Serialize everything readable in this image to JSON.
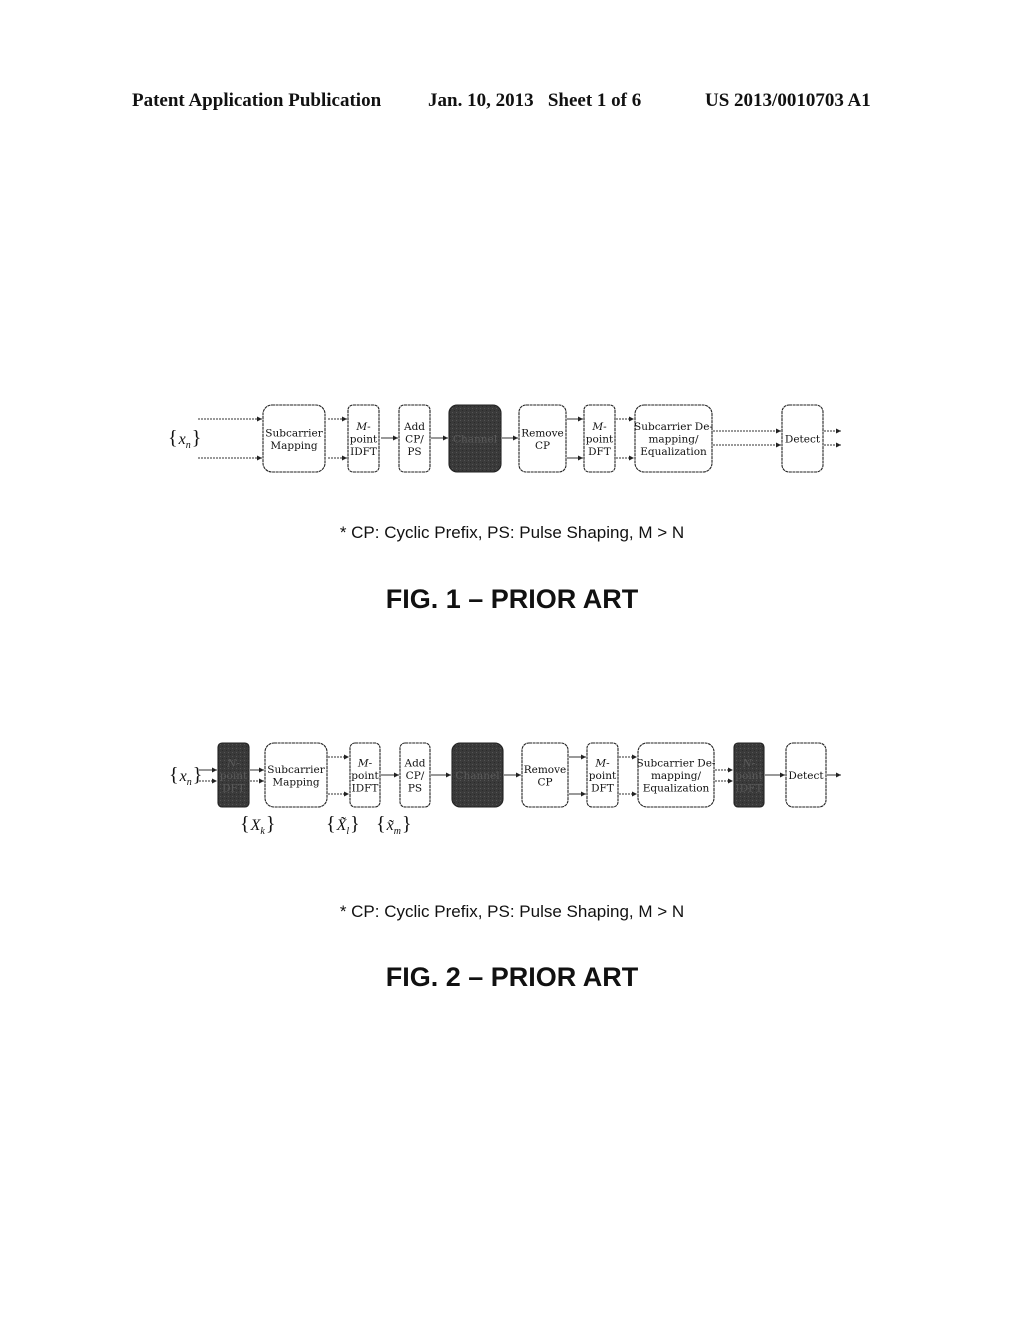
{
  "header": {
    "publication": "Patent Application Publication",
    "date_sheet": "Jan. 10, 2013   Sheet 1 of 6",
    "patent_number": "US 2013/0010703 A1"
  },
  "fig1": {
    "input_label": "{x_n}",
    "blocks": [
      {
        "id": "subcarrier-mapping",
        "lines": [
          "Subcarrier",
          "Mapping"
        ],
        "dark": false
      },
      {
        "id": "m-point-idft",
        "lines": [
          "M-",
          "point",
          "IDFT"
        ],
        "dark": false
      },
      {
        "id": "add-cp-ps",
        "lines": [
          "Add",
          "CP/",
          "PS"
        ],
        "dark": false
      },
      {
        "id": "channel",
        "lines": [
          "Channel"
        ],
        "dark": true
      },
      {
        "id": "remove-cp",
        "lines": [
          "Remove",
          "CP"
        ],
        "dark": false
      },
      {
        "id": "m-point-dft",
        "lines": [
          "M-",
          "point",
          "DFT"
        ],
        "dark": false
      },
      {
        "id": "subcarrier-demapping",
        "lines": [
          "Subcarrier De-",
          "mapping/",
          "Equalization"
        ],
        "dark": false
      },
      {
        "id": "detect",
        "lines": [
          "Detect"
        ],
        "dark": false
      }
    ],
    "note": "* CP: Cyclic Prefix, PS: Pulse Shaping, M > N",
    "caption": "FIG. 1 – PRIOR ART"
  },
  "fig2": {
    "input_label": "{x_n}",
    "blocks": [
      {
        "id": "n-point-dft",
        "lines": [
          "N-",
          "point",
          "DFT"
        ],
        "dark": true
      },
      {
        "id": "subcarrier-mapping",
        "lines": [
          "Subcarrier",
          "Mapping"
        ],
        "dark": false
      },
      {
        "id": "m-point-idft",
        "lines": [
          "M-",
          "point",
          "IDFT"
        ],
        "dark": false
      },
      {
        "id": "add-cp-ps",
        "lines": [
          "Add",
          "CP/",
          "PS"
        ],
        "dark": false
      },
      {
        "id": "channel",
        "lines": [
          "Channel"
        ],
        "dark": true
      },
      {
        "id": "remove-cp",
        "lines": [
          "Remove",
          "CP"
        ],
        "dark": false
      },
      {
        "id": "m-point-dft",
        "lines": [
          "M-",
          "point",
          "DFT"
        ],
        "dark": false
      },
      {
        "id": "subcarrier-demapping",
        "lines": [
          "Subcarrier De-",
          "mapping/",
          "Equalization"
        ],
        "dark": false
      },
      {
        "id": "n-point-idft",
        "lines": [
          "N-",
          "point",
          "IDFT"
        ],
        "dark": true
      },
      {
        "id": "detect",
        "lines": [
          "Detect"
        ],
        "dark": false
      }
    ],
    "signal_labels": [
      "{X_k}",
      "{X̃_l}",
      "{x̃_m}"
    ],
    "note": "* CP: Cyclic Prefix, PS: Pulse Shaping, M > N",
    "caption": "FIG. 2 – PRIOR ART"
  }
}
